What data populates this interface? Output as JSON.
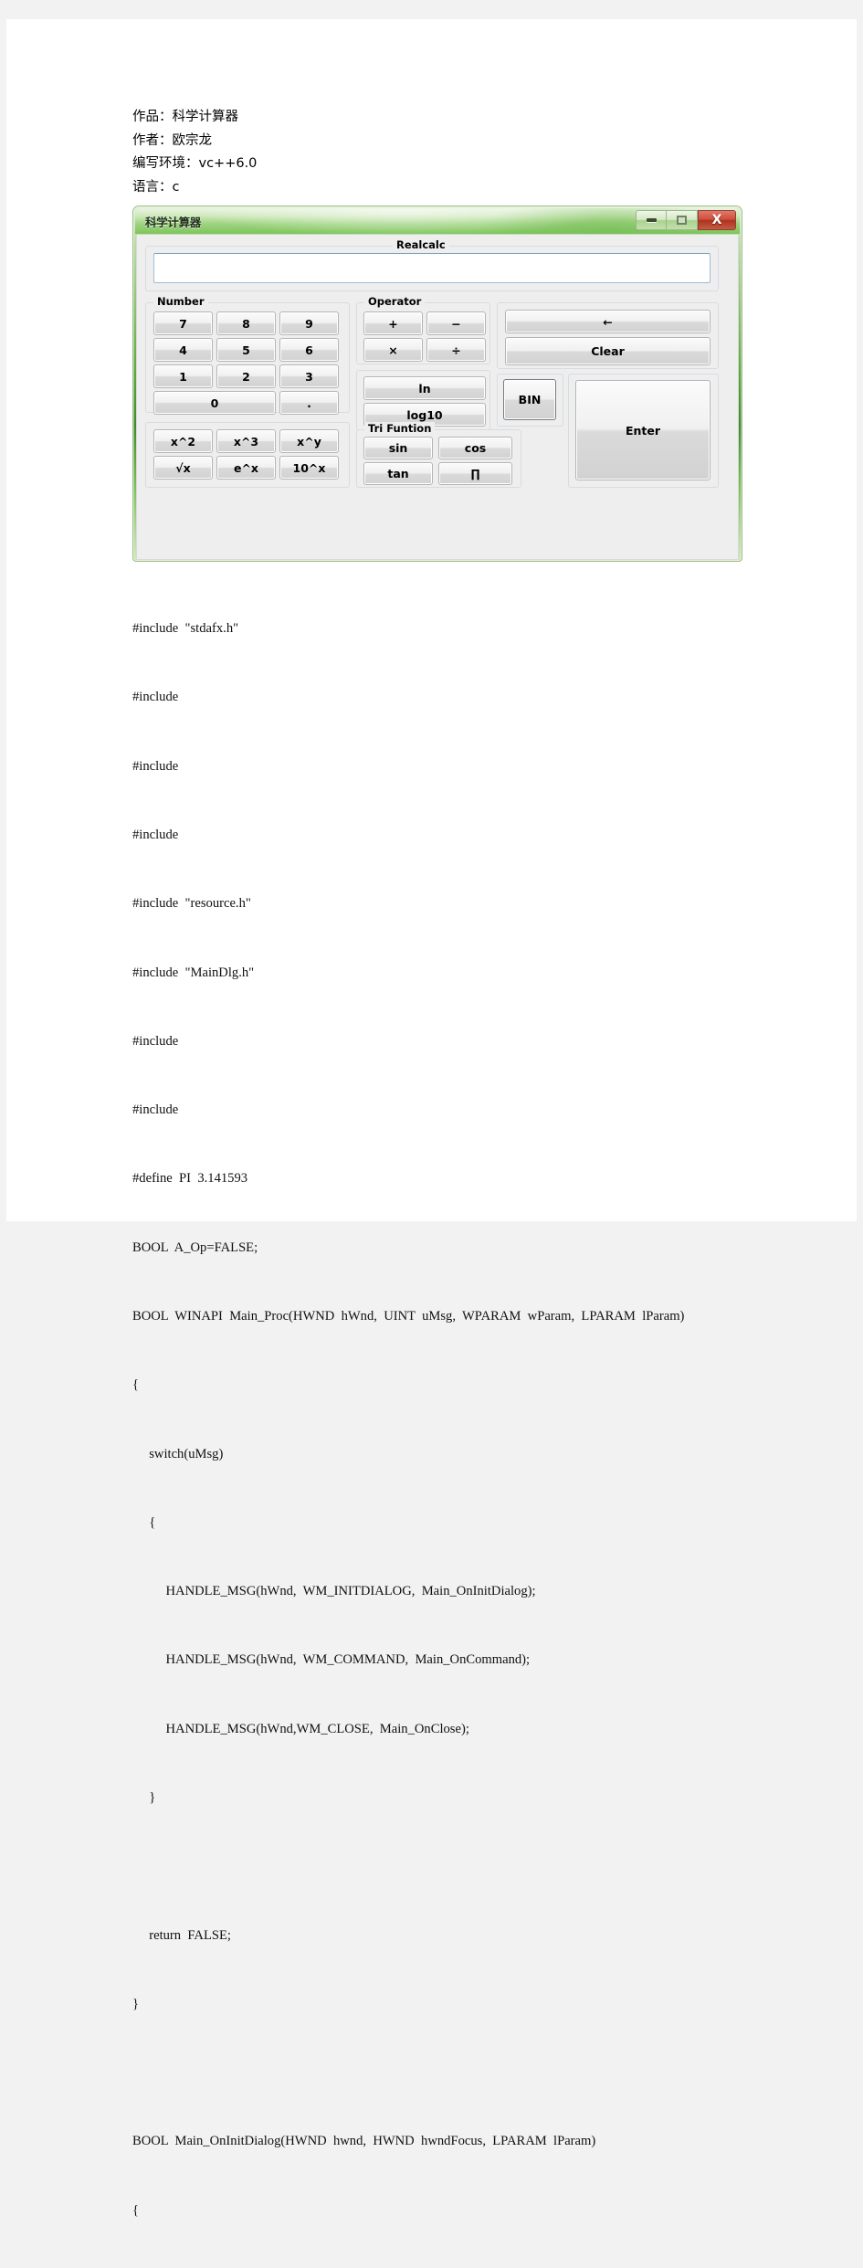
{
  "document": {
    "meta_lines": [
      "作品：科学计算器",
      "作者：欧宗龙",
      "编写环境：vc++6.0",
      "语言：c"
    ]
  },
  "calculator": {
    "window_title": "科学计算器",
    "window_buttons": {
      "minimize": "minimize-icon",
      "maximize": "maximize-icon",
      "close_label": "X"
    },
    "groups": {
      "realcalc_label": "Realcalc",
      "number_label": "Number",
      "operator_label": "Operator",
      "tri_function_label": "Tri Funtion"
    },
    "display": {
      "value": "",
      "placeholder": ""
    },
    "number_keys": [
      "7",
      "8",
      "9",
      "4",
      "5",
      "6",
      "1",
      "2",
      "3",
      "0",
      "."
    ],
    "operator_keys": [
      "+",
      "−",
      "×",
      "÷"
    ],
    "log_keys": [
      "ln",
      "log10"
    ],
    "tri_keys": [
      "sin",
      "cos",
      "tan",
      "∏"
    ],
    "power_keys": [
      "x^2",
      "x^3",
      "x^y",
      "√x",
      "e^x",
      "10^x"
    ],
    "action_keys": {
      "backspace": "←",
      "clear": "Clear",
      "bin": "BIN",
      "enter": "Enter"
    }
  },
  "code": {
    "lines": [
      "#include  \"stdafx.h\"",
      "#include",
      "#include",
      "#include",
      "#include  \"resource.h\"",
      "#include  \"MainDlg.h\"",
      "#include",
      "#include",
      "#define  PI  3.141593",
      "BOOL  A_Op=FALSE;",
      "BOOL  WINAPI  Main_Proc(HWND  hWnd,  UINT  uMsg,  WPARAM  wParam,  LPARAM  lParam)",
      "{",
      "     switch(uMsg)",
      "     {",
      "          HANDLE_MSG(hWnd,  WM_INITDIALOG,  Main_OnInitDialog);",
      "          HANDLE_MSG(hWnd,  WM_COMMAND,  Main_OnCommand);",
      "          HANDLE_MSG(hWnd,WM_CLOSE,  Main_OnClose);",
      "     }",
      "",
      "     return  FALSE;",
      "}",
      "",
      "BOOL  Main_OnInitDialog(HWND  hwnd,  HWND  hwndFocus,  LPARAM  lParam)",
      "{"
    ]
  }
}
